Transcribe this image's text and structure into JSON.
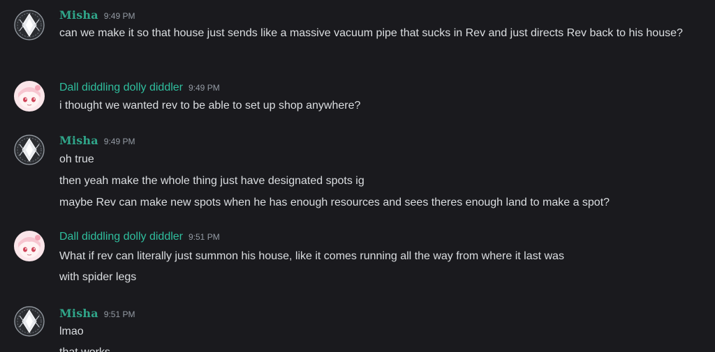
{
  "messages": [
    {
      "author": "Misha",
      "time": "9:49 PM",
      "lines": [
        "can we make it so that house just sends like a massive vacuum pipe that sucks in Rev and just directs Rev back to his house?"
      ]
    },
    {
      "author": "Dall diddling dolly diddler",
      "time": "9:49 PM",
      "lines": [
        "i thought we wanted rev to be able to set up shop anywhere?"
      ]
    },
    {
      "author": "Misha",
      "time": "9:49 PM",
      "lines": [
        "oh true",
        "then yeah make the whole thing just have designated spots ig",
        "maybe Rev can make new spots when he has enough resources and sees theres enough land to make a spot?"
      ]
    },
    {
      "author": "Dall diddling dolly diddler",
      "time": "9:51 PM",
      "lines": [
        "What if rev can literally just summon his house, like it comes running all the way from where it last was",
        "with spider legs"
      ]
    },
    {
      "author": "Misha",
      "time": "9:51 PM",
      "lines": [
        "lmao",
        "that works"
      ]
    }
  ],
  "colors": {
    "background": "#1a1a1e",
    "misha_name": "#30a68a",
    "dall_name": "#2fbf9e",
    "text": "#dbdee1",
    "timestamp": "#949ba4"
  },
  "icons": {
    "misha_avatar": "white-diamond-crest-avatar",
    "dall_avatar": "pink-anime-character-avatar"
  }
}
